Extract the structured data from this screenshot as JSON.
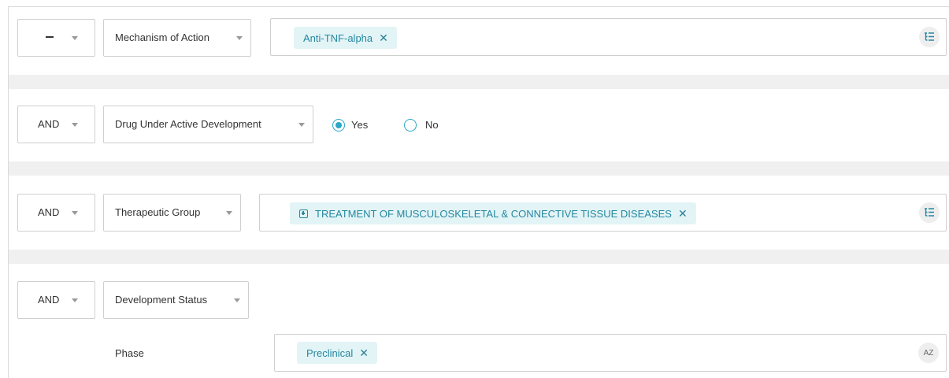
{
  "rows": [
    {
      "operator": "",
      "field": "Mechanism of Action",
      "chips": [
        {
          "label": "Anti-TNF-alpha"
        }
      ],
      "action_icon": "tree-list-icon"
    },
    {
      "operator": "AND",
      "field": "Drug Under Active Development",
      "options": [
        {
          "label": "Yes",
          "checked": true
        },
        {
          "label": "No",
          "checked": false
        }
      ]
    },
    {
      "operator": "AND",
      "field": "Therapeutic Group",
      "chips": [
        {
          "label": "TREATMENT OF MUSCULOSKELETAL & CONNECTIVE TISSUE DISEASES",
          "expandable": true
        }
      ],
      "action_icon": "tree-list-icon"
    },
    {
      "operator": "AND",
      "field": "Development Status",
      "sub_label": "Phase",
      "chips": [
        {
          "label": "Preclinical"
        }
      ],
      "action_icon": "sort-az-icon",
      "action_text": "AZ"
    }
  ],
  "chip_remove_glyph": "✕",
  "colors": {
    "accent": "#2ba7c7",
    "chip_bg": "#e3f4f6",
    "chip_text": "#2488a0",
    "separator": "#f0f0f0"
  }
}
